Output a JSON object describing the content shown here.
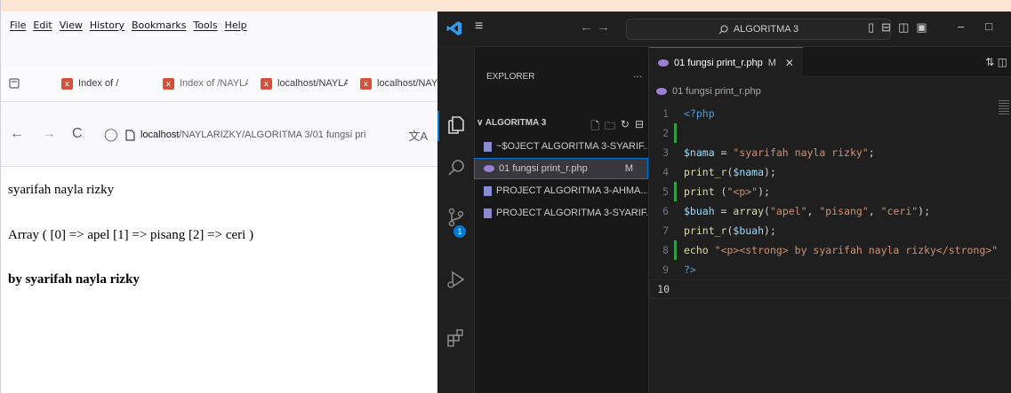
{
  "firefox": {
    "menu": [
      "File",
      "Edit",
      "View",
      "History",
      "Bookmarks",
      "Tools",
      "Help"
    ],
    "tabs": [
      {
        "label": "Index of /"
      },
      {
        "label": "Index of /NAYLA"
      },
      {
        "label": "localhost/NAYLA"
      },
      {
        "label": "localhost/NAYL"
      }
    ],
    "url": {
      "host": "localhost",
      "path": "/NAYLARIZKY/ALGORITMA 3/01 fungsi pri"
    },
    "content": {
      "line1": "syarifah nayla rizky",
      "line2": "Array ( [0] => apel [1] => pisang [2] => ceri )",
      "line3": "by syarifah nayla rizky"
    }
  },
  "vscode": {
    "search_label": "ALGORITMA 3",
    "explorer_label": "EXPLORER",
    "explorer_more": "···",
    "folder_label": "ALGORITMA 3",
    "source_control_badge": "1",
    "tree": [
      {
        "label": "~$OJECT ALGORITMA 3-SYARIF...",
        "git": ""
      },
      {
        "label": "01 fungsi print_r.php",
        "git": "M"
      },
      {
        "label": "PROJECT ALGORITMA 3-AHMA...",
        "git": ""
      },
      {
        "label": "PROJECT ALGORITMA 3-SYARIF...",
        "git": ""
      }
    ],
    "active_tab": {
      "label": "01 fungsi print_r.php",
      "status": "M"
    },
    "breadcrumb": "01 fungsi print_r.php",
    "code": [
      {
        "n": "1",
        "parts": [
          [
            "kw",
            "<?php"
          ]
        ]
      },
      {
        "n": "2",
        "parts": []
      },
      {
        "n": "3",
        "parts": [
          [
            "var",
            "$nama"
          ],
          [
            "op",
            " = "
          ],
          [
            "str",
            "\"syarifah nayla rizky\""
          ],
          [
            "op",
            ";"
          ]
        ]
      },
      {
        "n": "4",
        "parts": [
          [
            "fn",
            "print_r"
          ],
          [
            "op",
            "("
          ],
          [
            "var",
            "$nama"
          ],
          [
            "op",
            ");"
          ]
        ]
      },
      {
        "n": "5",
        "parts": [
          [
            "fn",
            "print"
          ],
          [
            "op",
            " ("
          ],
          [
            "str",
            "\"<p>\""
          ],
          [
            "op",
            ");"
          ]
        ]
      },
      {
        "n": "6",
        "parts": [
          [
            "var",
            "$buah"
          ],
          [
            "op",
            " = "
          ],
          [
            "fn",
            "array"
          ],
          [
            "op",
            "("
          ],
          [
            "str",
            "\"apel\""
          ],
          [
            "op",
            ", "
          ],
          [
            "str",
            "\"pisang\""
          ],
          [
            "op",
            ", "
          ],
          [
            "str",
            "\"ceri\""
          ],
          [
            "op",
            ");"
          ]
        ]
      },
      {
        "n": "7",
        "parts": [
          [
            "fn",
            "print_r"
          ],
          [
            "op",
            "("
          ],
          [
            "var",
            "$buah"
          ],
          [
            "op",
            ");"
          ]
        ]
      },
      {
        "n": "8",
        "parts": [
          [
            "fn",
            "echo"
          ],
          [
            "op",
            " "
          ],
          [
            "str",
            "\"<p><strong> by syarifah nayla rizky</strong>\""
          ]
        ]
      },
      {
        "n": "9",
        "parts": [
          [
            "kw",
            "?>"
          ]
        ]
      },
      {
        "n": "10",
        "parts": []
      }
    ]
  }
}
